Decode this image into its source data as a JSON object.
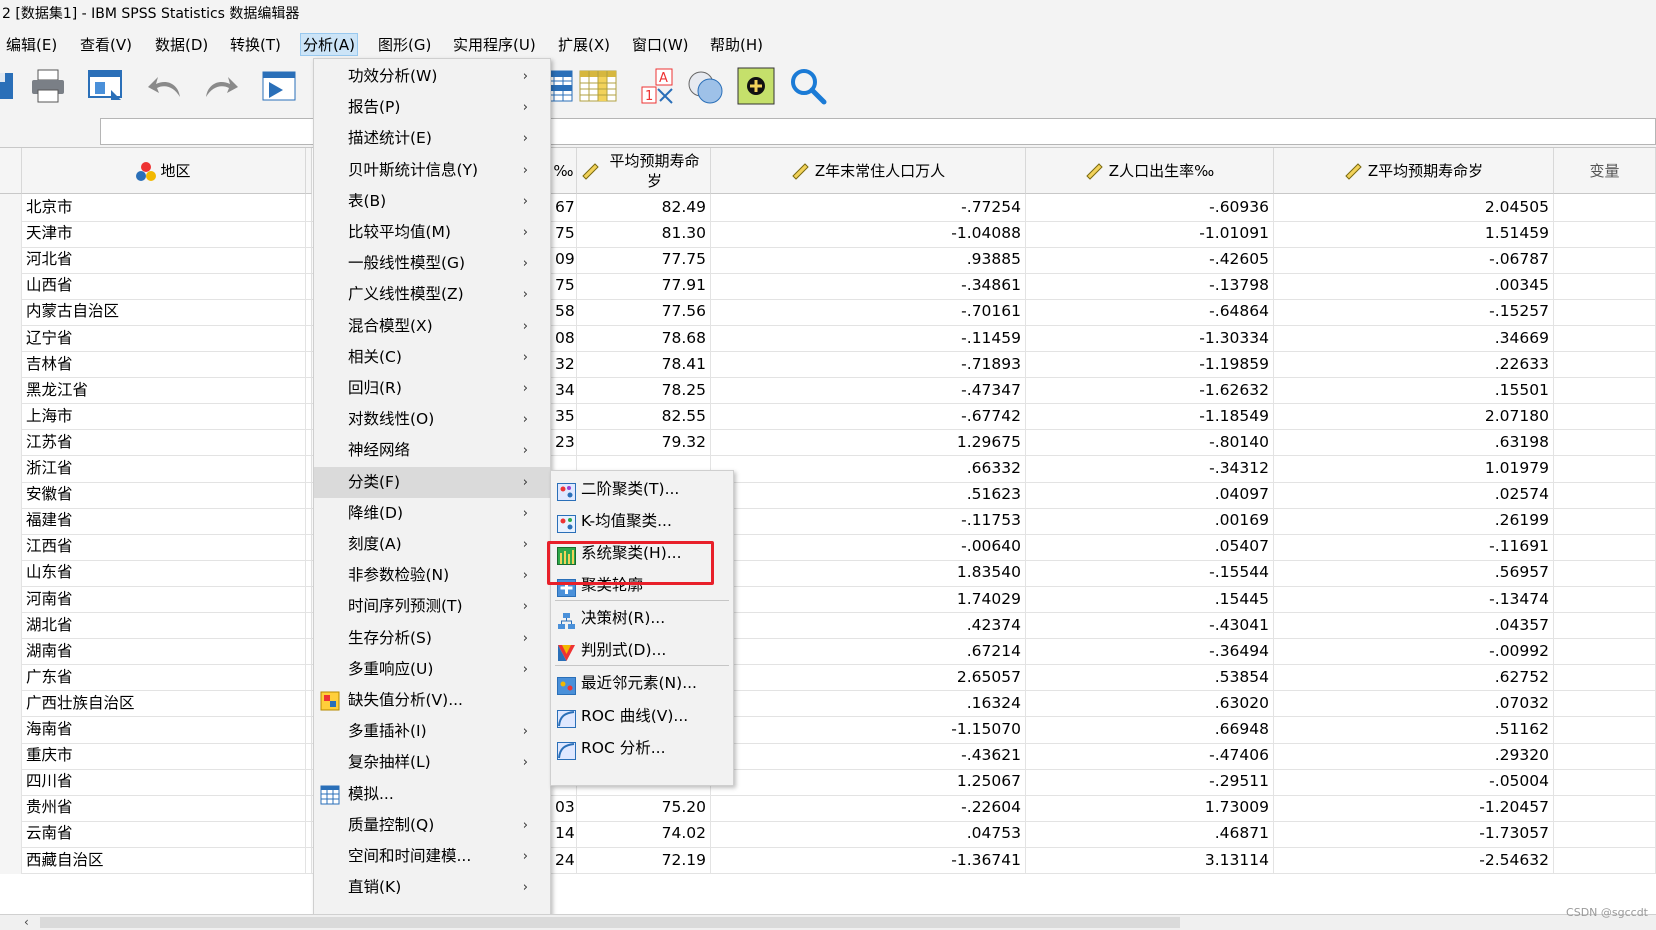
{
  "window": {
    "title": "2 [数据集1] - IBM SPSS Statistics 数据编辑器"
  },
  "menubar": [
    {
      "label": "编辑(E)"
    },
    {
      "label": "查看(V)"
    },
    {
      "label": "数据(D)"
    },
    {
      "label": "转换(T)"
    },
    {
      "label": "分析(A)"
    },
    {
      "label": "图形(G)"
    },
    {
      "label": "实用程序(U)"
    },
    {
      "label": "扩展(X)"
    },
    {
      "label": "窗口(W)"
    },
    {
      "label": "帮助(H)"
    }
  ],
  "toolbar": [
    "save-icon",
    "print-icon",
    "dialog-recall-icon",
    "undo-icon",
    "redo-icon",
    "goto-case-icon",
    "insert-cases-icon",
    "split-file-icon",
    "value-labels-icon",
    "use-sets-icon",
    "show-all-vars-icon",
    "find-icon"
  ],
  "grid": {
    "headers": [
      "地区",
      "‰",
      "平均预期寿命岁",
      "Z年末常住人口万人",
      "Z人口出生率‰",
      "Z平均预期寿命岁",
      "变量"
    ],
    "rows": [
      [
        "北京市",
        "67",
        "82.49",
        "-.77254",
        "-.60936",
        "2.04505"
      ],
      [
        "天津市",
        "75",
        "81.30",
        "-1.04088",
        "-1.01091",
        "1.51459"
      ],
      [
        "河北省",
        "09",
        "77.75",
        ".93885",
        "-.42605",
        "-.06787"
      ],
      [
        "山西省",
        "75",
        "77.91",
        "-.34861",
        "-.13798",
        ".00345"
      ],
      [
        "内蒙古自治区",
        "58",
        "77.56",
        "-.70161",
        "-.64864",
        "-.15257"
      ],
      [
        "辽宁省",
        "08",
        "78.68",
        "-.11459",
        "-1.30334",
        ".34669"
      ],
      [
        "吉林省",
        "32",
        "78.41",
        "-.71893",
        "-1.19859",
        ".22633"
      ],
      [
        "黑龙江省",
        "34",
        "78.25",
        "-.47347",
        "-1.62632",
        ".15501"
      ],
      [
        "上海市",
        "35",
        "82.55",
        "-.67742",
        "-1.18549",
        "2.07180"
      ],
      [
        "江苏省",
        "23",
        "79.32",
        "1.29675",
        "-.80140",
        ".63198"
      ],
      [
        "浙江省",
        "",
        "",
        ".66332",
        "-.34312",
        "1.01979"
      ],
      [
        "安徽省",
        "",
        "",
        ".51623",
        ".04097",
        ".02574"
      ],
      [
        "福建省",
        "",
        "",
        "-.11753",
        ".00169",
        ".26199"
      ],
      [
        "江西省",
        "",
        "",
        "-.00640",
        ".05407",
        "-.11691"
      ],
      [
        "山东省",
        "",
        "",
        "1.83540",
        "-.15544",
        ".56957"
      ],
      [
        "河南省",
        "",
        "",
        "1.74029",
        ".15445",
        "-.13474"
      ],
      [
        "湖北省",
        "",
        "",
        ".42374",
        "-.43041",
        ".04357"
      ],
      [
        "湖南省",
        "",
        "",
        ".67214",
        "-.36494",
        "-.00992"
      ],
      [
        "广东省",
        "",
        "",
        "2.65057",
        ".53854",
        ".62752"
      ],
      [
        "广西壮族自治区",
        "",
        "",
        ".16324",
        ".63020",
        ".07032"
      ],
      [
        "海南省",
        "",
        "",
        "-1.15070",
        ".66948",
        ".51162"
      ],
      [
        "重庆市",
        "96",
        "78.56",
        "-.43621",
        "-.47406",
        ".29320"
      ],
      [
        "四川省",
        "39",
        "77.79",
        "1.25067",
        "-.29511",
        "-.05004"
      ],
      [
        "贵州省",
        "03",
        "75.20",
        "-.22604",
        "1.73009",
        "-1.20457"
      ],
      [
        "云南省",
        "14",
        "74.02",
        ".04753",
        ".46871",
        "-1.73057"
      ],
      [
        "西藏自治区",
        "24",
        "72.19",
        "-1.36741",
        "3.13114",
        "-2.54632"
      ]
    ]
  },
  "analyze_menu": [
    {
      "label": "功效分析(W)",
      "arrow": "›"
    },
    {
      "label": "报告(P)",
      "arrow": "›"
    },
    {
      "label": "描述统计(E)",
      "arrow": "›"
    },
    {
      "label": "贝叶斯统计信息(Y)",
      "arrow": "›"
    },
    {
      "label": "表(B)",
      "arrow": "›"
    },
    {
      "label": "比较平均值(M)",
      "arrow": "›"
    },
    {
      "label": "一般线性模型(G)",
      "arrow": "›"
    },
    {
      "label": "广义线性模型(Z)",
      "arrow": "›"
    },
    {
      "label": "混合模型(X)",
      "arrow": "›"
    },
    {
      "label": "相关(C)",
      "arrow": "›"
    },
    {
      "label": "回归(R)",
      "arrow": "›"
    },
    {
      "label": "对数线性(O)",
      "arrow": "›"
    },
    {
      "label": "神经网络",
      "arrow": "›"
    },
    {
      "label": "分类(F)",
      "arrow": "›",
      "selected": true
    },
    {
      "label": "降维(D)",
      "arrow": "›"
    },
    {
      "label": "刻度(A)",
      "arrow": "›"
    },
    {
      "label": "非参数检验(N)",
      "arrow": "›"
    },
    {
      "label": "时间序列预测(T)",
      "arrow": "›"
    },
    {
      "label": "生存分析(S)",
      "arrow": "›"
    },
    {
      "label": "多重响应(U)",
      "arrow": "›"
    },
    {
      "label": "缺失值分析(V)...",
      "arrow": "",
      "icon": "missing-value-icon"
    },
    {
      "label": "多重插补(I)",
      "arrow": "›"
    },
    {
      "label": "复杂抽样(L)",
      "arrow": "›"
    },
    {
      "label": "模拟...",
      "arrow": "",
      "icon": "simulation-icon"
    },
    {
      "label": "质量控制(Q)",
      "arrow": "›"
    },
    {
      "label": "空间和时间建模...",
      "arrow": "›"
    },
    {
      "label": "直销(K)",
      "arrow": "›"
    }
  ],
  "classify_submenu": [
    {
      "label": "二阶聚类(T)...",
      "icon": "twostep-cluster-icon"
    },
    {
      "label": "K-均值聚类...",
      "icon": "kmeans-cluster-icon"
    },
    {
      "label": "系统聚类(H)...",
      "icon": "hierarchical-cluster-icon",
      "highlighted": true
    },
    {
      "label": "聚类轮廓",
      "icon": "cluster-silhouette-icon"
    },
    {
      "label": "决策树(R)...",
      "icon": "decision-tree-icon"
    },
    {
      "label": "判别式(D)...",
      "icon": "discriminant-icon"
    },
    {
      "label": "最近邻元素(N)...",
      "icon": "nearest-neighbor-icon"
    },
    {
      "label": "ROC 曲线(V)...",
      "icon": "roc-curve-icon"
    },
    {
      "label": "ROC 分析...",
      "icon": "roc-analysis-icon"
    }
  ],
  "watermark": "CSDN @sgccdt",
  "colors": {
    "highlight_box": "#e8202a",
    "menu_bg": "#f2f2f2",
    "selected_item": "#dadada"
  }
}
